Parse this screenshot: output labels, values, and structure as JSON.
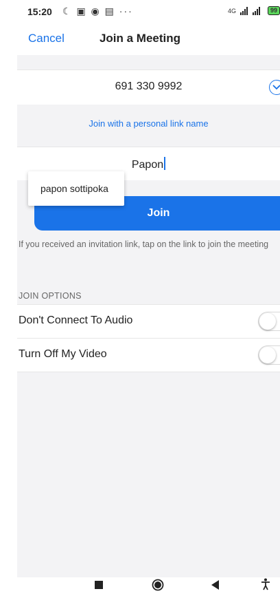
{
  "status_bar": {
    "time": "15:20",
    "notification_icons": "☾ ▣ ◉ ▤ ···",
    "network": "4G",
    "battery": "99"
  },
  "header": {
    "cancel_label": "Cancel",
    "title": "Join a Meeting"
  },
  "meeting": {
    "id": "691 330 9992"
  },
  "personal_link": "Join with a personal link name",
  "name_field": {
    "value": "Papon"
  },
  "suggestion": {
    "text": "papon sottipoka"
  },
  "join_button": "Join",
  "hint": "If you received an invitation link, tap on the link to join the meeting",
  "join_options": {
    "section_label": "JOIN OPTIONS",
    "options": [
      {
        "label": "Don't Connect To Audio",
        "enabled": false
      },
      {
        "label": "Turn Off My Video",
        "enabled": false
      }
    ]
  },
  "colors": {
    "accent": "#1a73e8",
    "background": "#f3f3f5"
  }
}
